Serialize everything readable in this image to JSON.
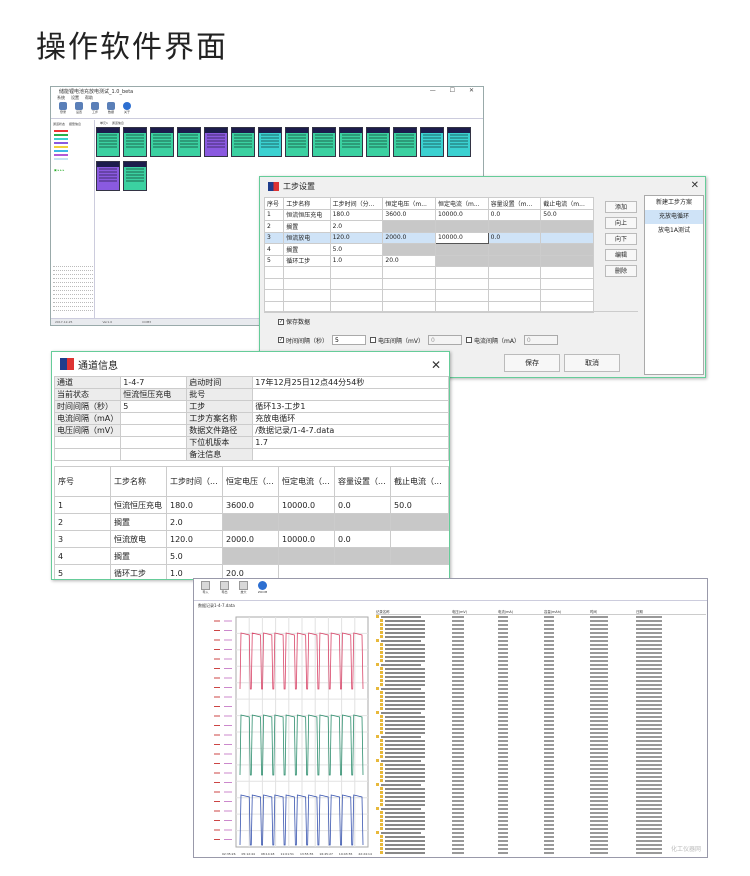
{
  "heading": "操作软件界面",
  "app_window": {
    "title": "储能锂电池充放电测试_1.0_beta",
    "menu": [
      "系统",
      "设置",
      "帮助"
    ],
    "toolbar": [
      "登录",
      "设置",
      "工步",
      "数据",
      "关于"
    ],
    "left_tabs": [
      "通道状态",
      "报警信息"
    ],
    "main_tabs": [
      "单元1",
      "通道信息"
    ],
    "status": [
      "2017-12-25",
      "Ver1.0",
      "COM3"
    ]
  },
  "step_dialog": {
    "title": "工步设置",
    "columns": [
      "序号",
      "工步名称",
      "工步时间（分...",
      "恒定电压（m...",
      "恒定电流（m...",
      "容量设置（m...",
      "截止电流（m..."
    ],
    "rows": [
      [
        "1",
        "恒流恒压充电",
        "180.0",
        "3600.0",
        "10000.0",
        "0.0",
        "50.0"
      ],
      [
        "2",
        "搁置",
        "2.0",
        "",
        "",
        "",
        ""
      ],
      [
        "3",
        "恒流放电",
        "120.0",
        "2000.0",
        "10000.0",
        "0.0",
        ""
      ],
      [
        "4",
        "搁置",
        "5.0",
        "",
        "",
        "",
        ""
      ],
      [
        "5",
        "循环工步",
        "1.0",
        "20.0",
        "",
        "",
        ""
      ]
    ],
    "buttons": [
      "添加",
      "向上",
      "向下",
      "编辑",
      "删除"
    ],
    "schemes": [
      "新建工步方案",
      "充放电循环",
      "放电1A测试"
    ],
    "save_data_label": "保存数据",
    "time_interval_label": "时间间隔（秒）",
    "time_interval_value": "5",
    "voltage_interval_label": "电压间隔（mV）",
    "voltage_interval_value": "0",
    "current_interval_label": "电流间隔（mA）",
    "current_interval_value": "0",
    "save_button": "保存",
    "cancel_button": "取消"
  },
  "info_dialog": {
    "title": "通道信息",
    "fields": [
      [
        "通道",
        "1-4-7",
        "启动时间",
        "17年12月25日12点44分54秒"
      ],
      [
        "当前状态",
        "恒流恒压充电",
        "批号",
        ""
      ],
      [
        "时间间隔（秒）",
        "5",
        "工步",
        "循环13-工步1"
      ],
      [
        "电流间隔（mA）",
        "",
        "工步方案名称",
        "充放电循环"
      ],
      [
        "电压间隔（mV）",
        "",
        "数据文件路径",
        "/数据记录/1-4-7.data"
      ],
      [
        "",
        "",
        "下位机版本",
        "1.7"
      ],
      [
        "",
        "",
        "备注信息",
        ""
      ]
    ],
    "columns": [
      "序号",
      "工步名称",
      "工步时间（...",
      "恒定电压（...",
      "恒定电流（...",
      "容量设置（...",
      "截止电流（..."
    ],
    "rows": [
      [
        "1",
        "恒流恒压充电",
        "180.0",
        "3600.0",
        "10000.0",
        "0.0",
        "50.0"
      ],
      [
        "2",
        "搁置",
        "2.0",
        "",
        "",
        "",
        ""
      ],
      [
        "3",
        "恒流放电",
        "120.0",
        "2000.0",
        "10000.0",
        "0.0",
        ""
      ],
      [
        "4",
        "搁置",
        "5.0",
        "",
        "",
        "",
        ""
      ],
      [
        "5",
        "循环工步",
        "1.0",
        "20.0",
        "",
        "",
        ""
      ]
    ]
  },
  "data_window": {
    "toolbar": [
      "导入",
      "导出",
      "放大",
      "ZOOM"
    ],
    "tab": "数据记录1-4-7.data",
    "log_header": [
      "记录名称",
      "电压(mV)",
      "电流(mA)",
      "容量(mAh)",
      "时间",
      "日期"
    ],
    "x_ticks": [
      "02:35:26",
      "05:12:44",
      "08:14:18",
      "11:01:51",
      "13:55:55",
      "16:45:27",
      "19:43:55",
      "22:24:14"
    ],
    "watermark": "化工仪器网"
  }
}
